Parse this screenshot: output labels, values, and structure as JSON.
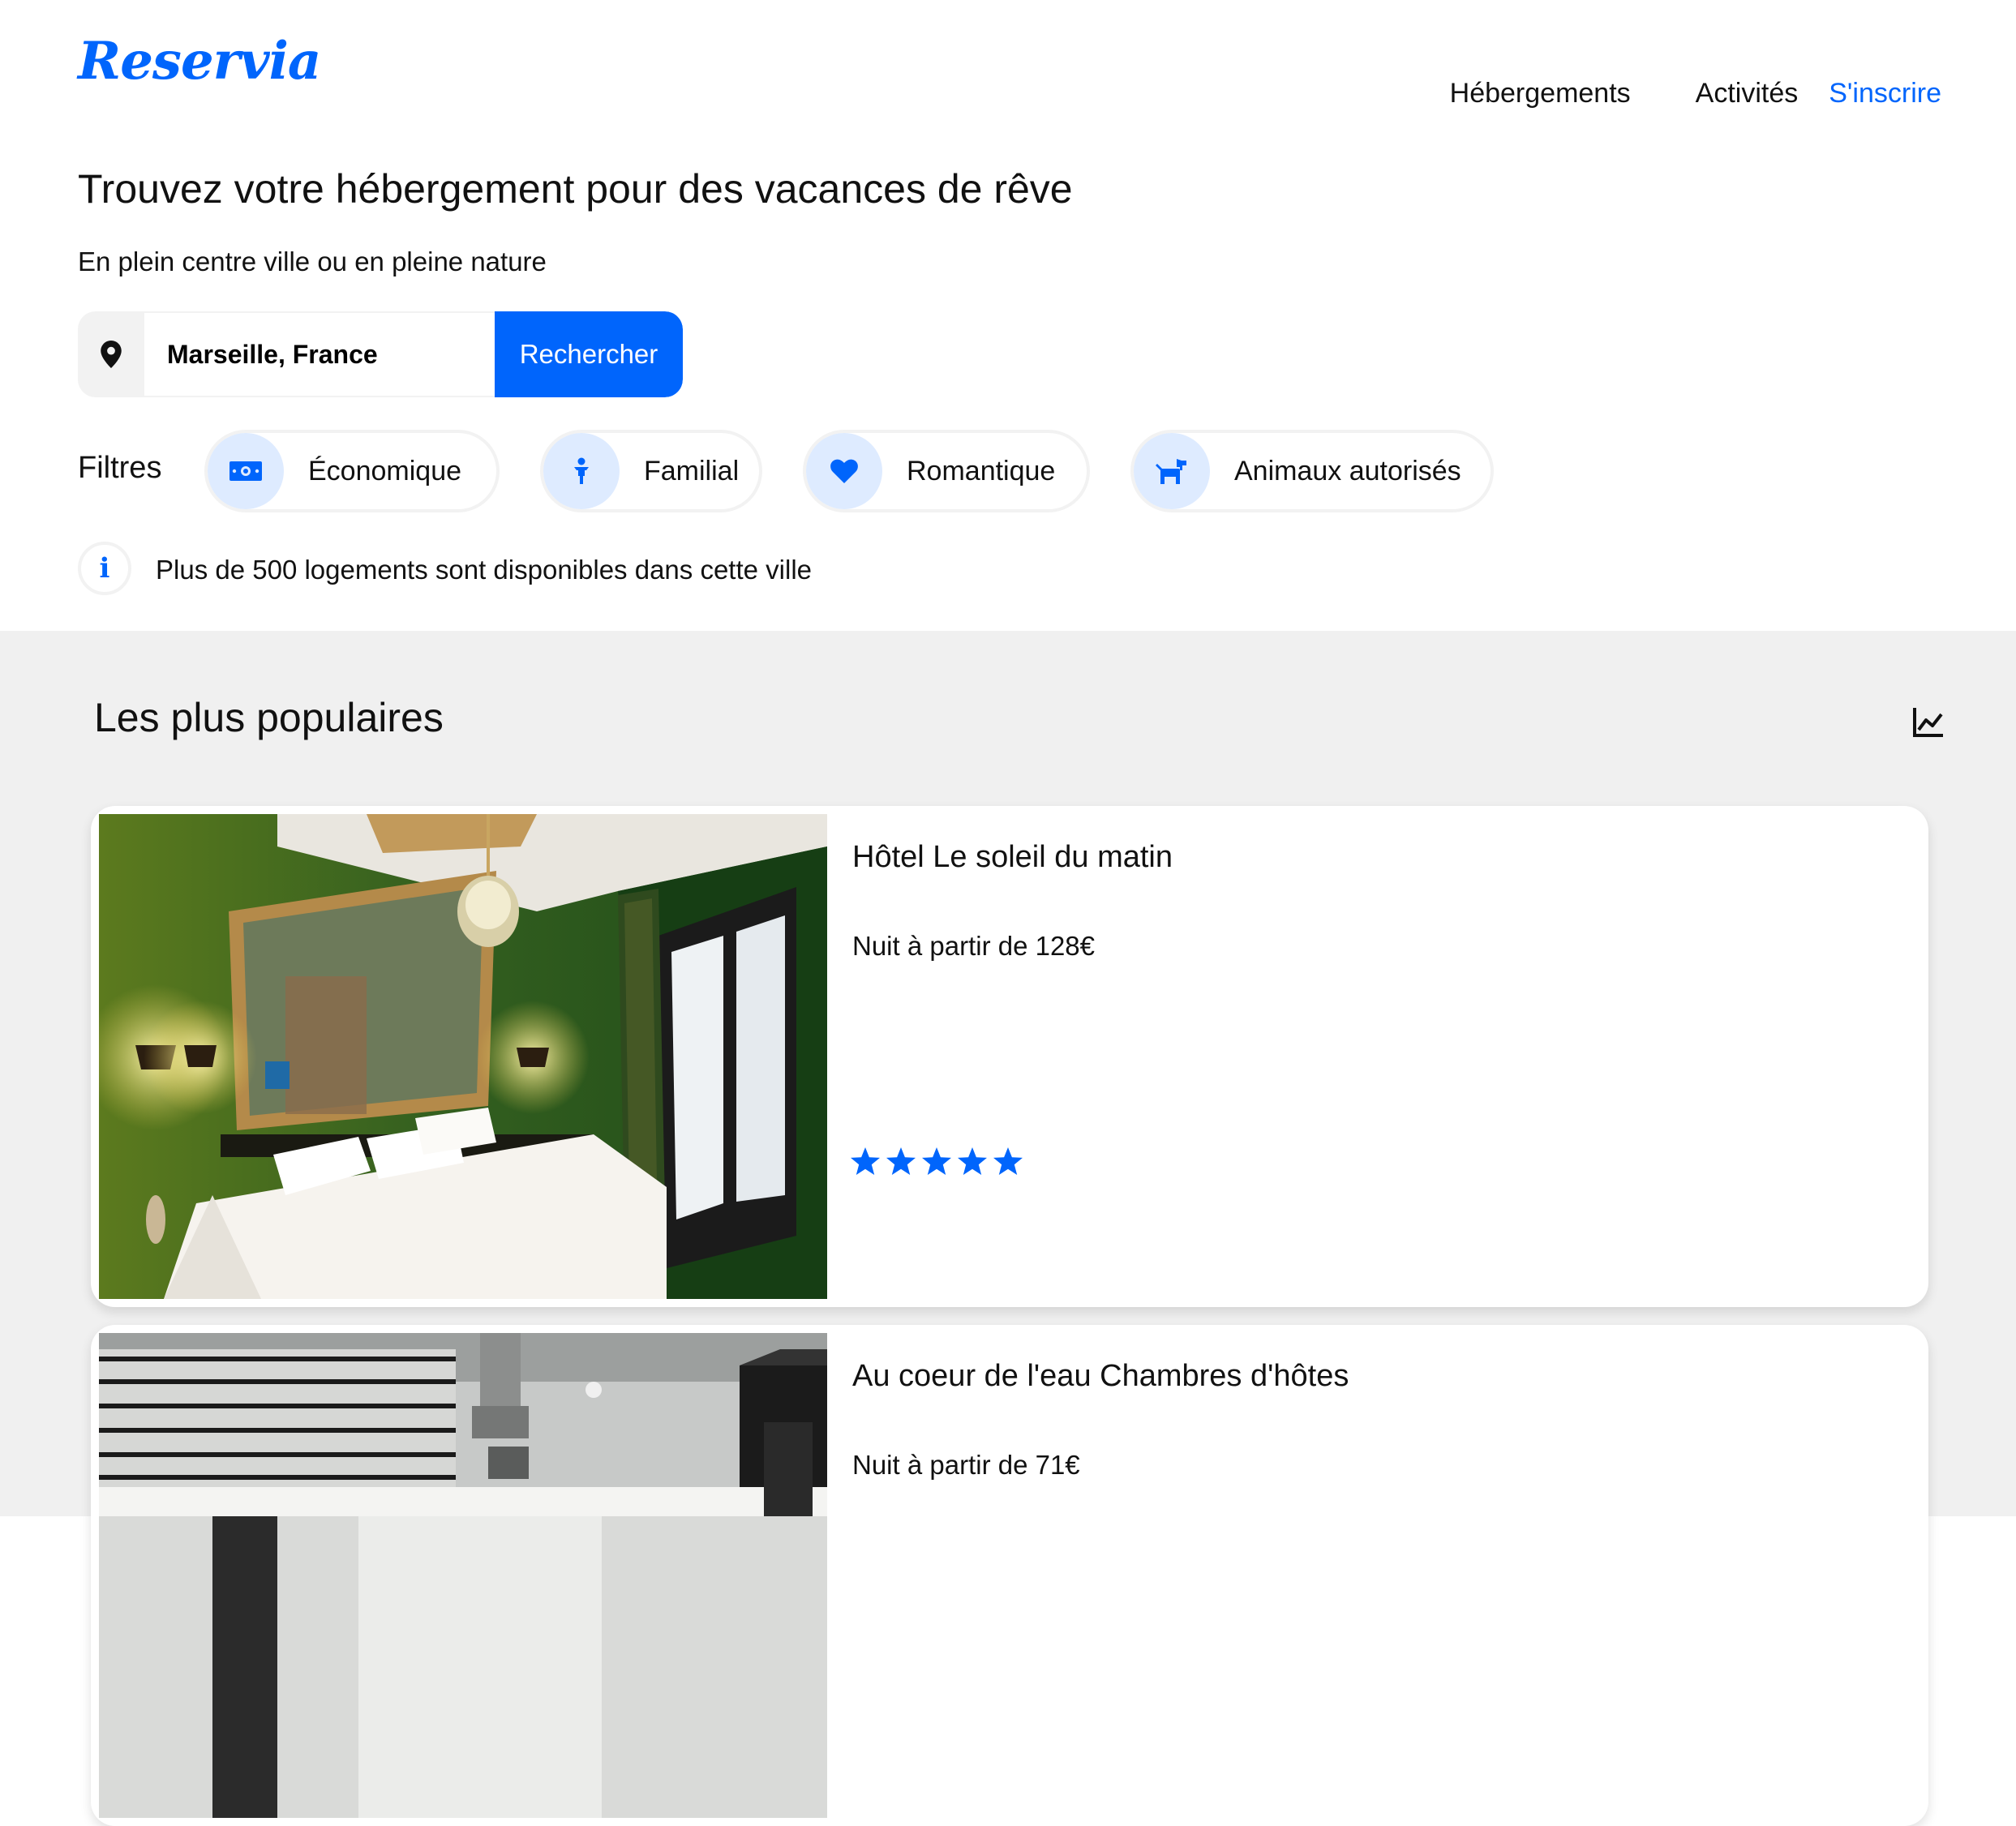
{
  "brand": {
    "logo_text": "Reservia",
    "accent_color": "#0065fc"
  },
  "nav": {
    "items": [
      {
        "label": "Hébergements"
      },
      {
        "label": "Activités"
      }
    ],
    "signup_label": "S'inscrire"
  },
  "hero": {
    "title": "Trouvez votre hébergement pour des vacances de rêve",
    "subtitle": "En plein centre ville ou en pleine nature"
  },
  "search": {
    "location_icon": "map-pin-icon",
    "value": "Marseille, France",
    "button_label": "Rechercher"
  },
  "filters": {
    "label": "Filtres",
    "items": [
      {
        "label": "Économique",
        "icon": "money-icon"
      },
      {
        "label": "Familial",
        "icon": "child-icon"
      },
      {
        "label": "Romantique",
        "icon": "heart-icon"
      },
      {
        "label": "Animaux autorisés",
        "icon": "dog-icon"
      }
    ]
  },
  "info": {
    "icon": "info-icon",
    "text": "Plus de 500 logements sont disponibles dans cette ville"
  },
  "popular": {
    "title": "Les plus populaires",
    "trend_icon": "chart-line-icon",
    "cards": [
      {
        "name": "Hôtel Le soleil du matin",
        "price": "Nuit à partir de 128€",
        "rating": 5,
        "rating_max": 5
      },
      {
        "name": "Au coeur de l'eau Chambres d'hôtes",
        "price": "Nuit à partir de 71€"
      }
    ]
  }
}
